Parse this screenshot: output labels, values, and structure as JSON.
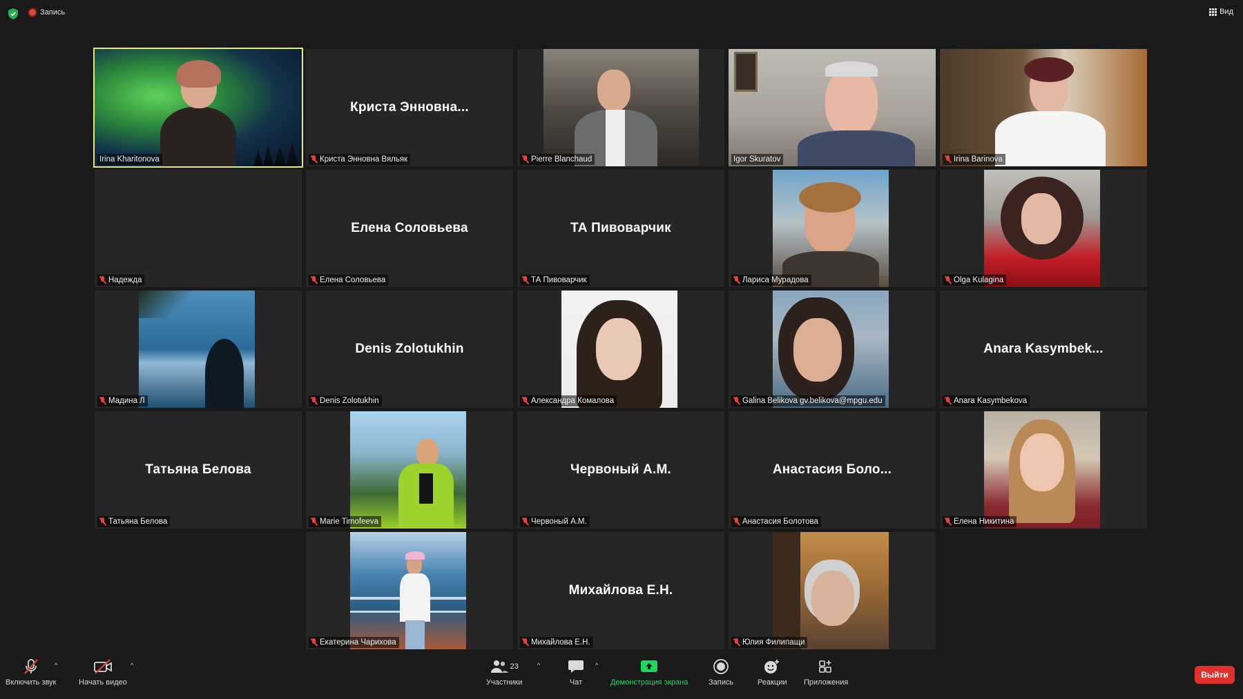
{
  "topbar": {
    "recording_label": "Запись",
    "view_label": "Вид"
  },
  "participants": [
    {
      "name": "Irina Kharitonova",
      "display": "",
      "muted": false,
      "video": true,
      "active": true
    },
    {
      "name": "Криста Энновна Вяльяк",
      "display": "Криста  Энновна...",
      "muted": true,
      "video": false
    },
    {
      "name": "Pierre Blanchaud",
      "display": "",
      "muted": true,
      "video": true
    },
    {
      "name": "Igor Skuratov",
      "display": "",
      "muted": false,
      "video": true
    },
    {
      "name": "Irina Barinova",
      "display": "",
      "muted": true,
      "video": true
    },
    {
      "name": "Надежда",
      "display": "",
      "muted": true,
      "video": false
    },
    {
      "name": "Елена Соловьева",
      "display": "Елена Соловьева",
      "muted": true,
      "video": false
    },
    {
      "name": "ТА Пивоварчик",
      "display": "ТА Пивоварчик",
      "muted": true,
      "video": false
    },
    {
      "name": "Лариса Мурадова",
      "display": "",
      "muted": true,
      "video": true
    },
    {
      "name": "Olga Kulagina",
      "display": "",
      "muted": true,
      "video": true
    },
    {
      "name": "Мадина Л",
      "display": "",
      "muted": true,
      "video": true
    },
    {
      "name": "Denis Zolotukhin",
      "display": "Denis Zolotukhin",
      "muted": true,
      "video": false
    },
    {
      "name": "Александра Комалова",
      "display": "",
      "muted": true,
      "video": true
    },
    {
      "name": "Galina Belikova gv.belikova@mpgu.edu",
      "display": "",
      "muted": true,
      "video": true
    },
    {
      "name": "Anara Kasymbekova",
      "display": "Anara  Kasymbek...",
      "muted": true,
      "video": false
    },
    {
      "name": "Татьяна Белова",
      "display": "Татьяна Белова",
      "muted": true,
      "video": false
    },
    {
      "name": "Marie Timofeeva",
      "display": "",
      "muted": true,
      "video": true
    },
    {
      "name": "Червоный А.М.",
      "display": "Червоный А.М.",
      "muted": true,
      "video": false
    },
    {
      "name": "Анастасия Болотова",
      "display": "Анастасия  Боло...",
      "muted": true,
      "video": false
    },
    {
      "name": "Елена Никитина",
      "display": "",
      "muted": true,
      "video": true
    },
    {
      "name": "Екатерина Чарихова",
      "display": "",
      "muted": true,
      "video": true
    },
    {
      "name": "Михайлова Е.Н.",
      "display": "Михайлова Е.Н.",
      "muted": true,
      "video": false
    },
    {
      "name": "Юлия Филипащи",
      "display": "",
      "muted": true,
      "video": true
    }
  ],
  "toolbar": {
    "unmute_label": "Включить звук",
    "start_video_label": "Начать видео",
    "participants_label": "Участники",
    "participants_count": "23",
    "chat_label": "Чат",
    "share_label": "Демонстрация экрана",
    "record_label": "Запись",
    "reactions_label": "Реакции",
    "apps_label": "Приложения",
    "exit_label": "Выйти"
  },
  "colors": {
    "active_speaker": "#e3ef6a",
    "muted_icon": "#e0453c",
    "share_green": "#1ed760",
    "exit_red": "#e0302c"
  }
}
